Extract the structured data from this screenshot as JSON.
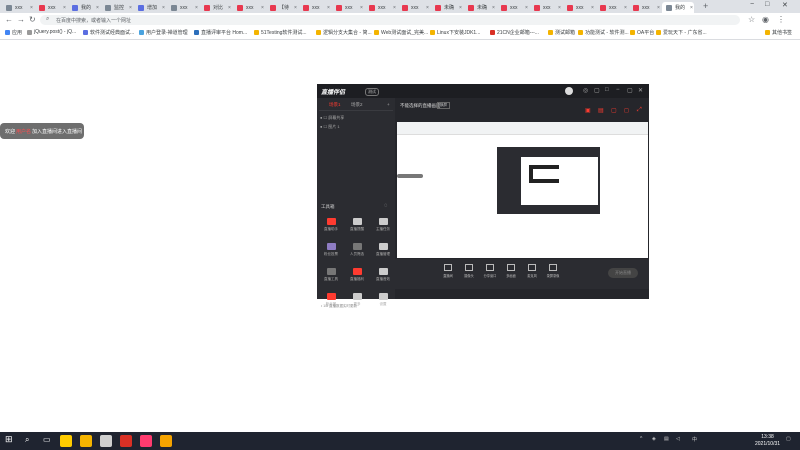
{
  "browser": {
    "tabs": [
      {
        "label": "xxx",
        "color": "#7b8794"
      },
      {
        "label": "xxx",
        "color": "#e8384f"
      },
      {
        "label": "我的",
        "color": "#5b6ee1"
      },
      {
        "label": "监控",
        "color": "#7b8794"
      },
      {
        "label": "增加",
        "color": "#5b6ee1"
      },
      {
        "label": "xxx",
        "color": "#7b8794"
      },
      {
        "label": "对比",
        "color": "#e8384f"
      },
      {
        "label": "xxx",
        "color": "#e8384f"
      },
      {
        "label": "【待",
        "color": "#e8384f"
      },
      {
        "label": "xxx",
        "color": "#e8384f"
      },
      {
        "label": "xxx",
        "color": "#e8384f"
      },
      {
        "label": "xxx",
        "color": "#e8384f"
      },
      {
        "label": "xxx",
        "color": "#e8384f"
      },
      {
        "label": "未确",
        "color": "#e8384f"
      },
      {
        "label": "未确",
        "color": "#e8384f"
      },
      {
        "label": "xxx",
        "color": "#e8384f"
      },
      {
        "label": "xxx",
        "color": "#e8384f"
      },
      {
        "label": "xxx",
        "color": "#e8384f"
      },
      {
        "label": "xxx",
        "color": "#e8384f"
      },
      {
        "label": "xxx",
        "color": "#e8384f"
      },
      {
        "label": "我的",
        "color": "#7b8794"
      }
    ],
    "new_tab": "+",
    "window_controls": {
      "minimize": "−",
      "maximize": "□",
      "close": "✕"
    },
    "nav": {
      "back": "←",
      "forward": "→",
      "reload": "↻"
    },
    "omnibox": {
      "placeholder": "在百度中搜索，或者输入一个网址"
    },
    "bookmarks": [
      {
        "label": "应用",
        "color": "#4285f4"
      },
      {
        "label": "jQuery.post() - jQ...",
        "color": "#999999"
      },
      {
        "label": "软件测试经典面试...",
        "color": "#5b6ee1"
      },
      {
        "label": "用户登录-禅道管理",
        "color": "#4aa3df"
      },
      {
        "label": "直播评审平台 Hom...",
        "color": "#2c6fbb"
      },
      {
        "label": "51Testing软件测试...",
        "color": "#f4b400"
      },
      {
        "label": "逻辑分支大集合 - 简...",
        "color": "#f4b400"
      },
      {
        "label": "Web测试面试_完美...",
        "color": "#f4b400"
      },
      {
        "label": "Linux下安装JDK1...",
        "color": "#f4b400"
      },
      {
        "label": "21CN企业邮箱---...",
        "color": "#d93025"
      },
      {
        "label": "测试邮箱",
        "color": "#f4b400"
      },
      {
        "label": "功能测试 - 软件测...",
        "color": "#f4b400"
      },
      {
        "label": "OA平台",
        "color": "#f4b400"
      },
      {
        "label": "爱玩天下 - 广东省...",
        "color": "#f4b400"
      },
      {
        "label": "其他书签",
        "color": "#f4b400"
      }
    ]
  },
  "toast": {
    "prefix": "欢迎",
    "highlight": "用户名",
    "suffix": "加入直播间进入直播间"
  },
  "app": {
    "brand": "直播伴侣",
    "brand_badge": "测试",
    "window_controls": [
      "◎",
      "▢",
      "□",
      "−",
      "▢",
      "✕"
    ],
    "sidebar_tabs": [
      "场景1",
      "场景2",
      "+"
    ],
    "sidebar_sources": [
      "● ☐ 屏幕共享",
      "● ☐ 图片 1"
    ],
    "tools_title": "工具箱",
    "tools": [
      {
        "label": "直播助手",
        "color": "#ff3b30"
      },
      {
        "label": "直播提醒",
        "color": "#cccccc"
      },
      {
        "label": "主播任务",
        "color": "#cccccc"
      },
      {
        "label": "粉丝投票",
        "color": "#8e7cc3"
      },
      {
        "label": "人员筛选",
        "color": "#777777"
      },
      {
        "label": "直播管理",
        "color": "#cccccc"
      },
      {
        "label": "直播工具",
        "color": "#777777"
      },
      {
        "label": "直播福利",
        "color": "#ff3b30"
      },
      {
        "label": "直播音效",
        "color": "#cccccc"
      },
      {
        "label": "粉丝团",
        "color": "#ff3b30"
      },
      {
        "label": "更多",
        "color": "#cccccc"
      },
      {
        "label": "设置",
        "color": "#cccccc"
      }
    ],
    "sidebar_footer": "• 1/8 直播数据实时更新",
    "stage": {
      "title": "不能选择的直播画面",
      "badge": "横屏",
      "icons": [
        "▣",
        "▤",
        "▢",
        "◻",
        "⤢"
      ],
      "controls": [
        "直播间",
        "摄像头",
        "分享窗口",
        "多画面",
        "麦克风",
        "录屏录像"
      ],
      "go_live_label": "开始直播",
      "status_left": "",
      "status_right": ""
    }
  },
  "taskbar": {
    "apps": [
      {
        "name": "chrome",
        "color": "#ffcc00"
      },
      {
        "name": "files",
        "color": "#f4b400"
      },
      {
        "name": "app3",
        "color": "#cfcfcf"
      },
      {
        "name": "app4",
        "color": "#d93025"
      },
      {
        "name": "app5",
        "color": "#ff3b6f"
      },
      {
        "name": "app6",
        "color": "#f4a300"
      }
    ],
    "time": "13:38",
    "date": "2021/10/31"
  }
}
